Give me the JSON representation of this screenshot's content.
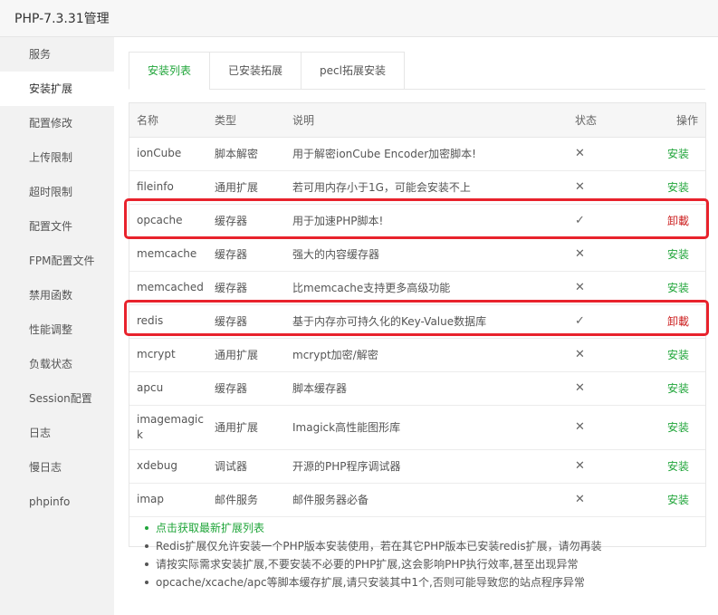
{
  "window": {
    "title": "PHP-7.3.31管理"
  },
  "sidebar": {
    "items": [
      {
        "label": "服务",
        "active": false
      },
      {
        "label": "安装扩展",
        "active": true
      },
      {
        "label": "配置修改",
        "active": false
      },
      {
        "label": "上传限制",
        "active": false
      },
      {
        "label": "超时限制",
        "active": false
      },
      {
        "label": "配置文件",
        "active": false
      },
      {
        "label": "FPM配置文件",
        "active": false
      },
      {
        "label": "禁用函数",
        "active": false
      },
      {
        "label": "性能调整",
        "active": false
      },
      {
        "label": "负载状态",
        "active": false
      },
      {
        "label": "Session配置",
        "active": false
      },
      {
        "label": "日志",
        "active": false
      },
      {
        "label": "慢日志",
        "active": false
      },
      {
        "label": "phpinfo",
        "active": false
      }
    ]
  },
  "tabs": [
    {
      "label": "安装列表",
      "active": true
    },
    {
      "label": "已安装拓展",
      "active": false
    },
    {
      "label": "pecl拓展安装",
      "active": false
    }
  ],
  "table": {
    "headers": {
      "name": "名称",
      "type": "类型",
      "desc": "说明",
      "status": "状态",
      "op": "操作"
    },
    "rows": [
      {
        "name": "ionCube",
        "type": "脚本解密",
        "desc": "用于解密ionCube Encoder加密脚本!",
        "status": "✕",
        "op": "安装",
        "installed": false
      },
      {
        "name": "fileinfo",
        "type": "通用扩展",
        "desc": "若可用内存小于1G，可能会安装不上",
        "status": "✕",
        "op": "安装",
        "installed": false
      },
      {
        "name": "opcache",
        "type": "缓存器",
        "desc": "用于加速PHP脚本!",
        "status": "✓",
        "op": "卸載",
        "installed": true
      },
      {
        "name": "memcache",
        "type": "缓存器",
        "desc": "强大的内容缓存器",
        "status": "✕",
        "op": "安装",
        "installed": false
      },
      {
        "name": "memcached",
        "type": "缓存器",
        "desc": "比memcache支持更多高级功能",
        "status": "✕",
        "op": "安装",
        "installed": false
      },
      {
        "name": "redis",
        "type": "缓存器",
        "desc": "基于内存亦可持久化的Key-Value数据库",
        "status": "✓",
        "op": "卸載",
        "installed": true
      },
      {
        "name": "mcrypt",
        "type": "通用扩展",
        "desc": "mcrypt加密/解密",
        "status": "✕",
        "op": "安装",
        "installed": false
      },
      {
        "name": "apcu",
        "type": "缓存器",
        "desc": "脚本缓存器",
        "status": "✕",
        "op": "安装",
        "installed": false
      },
      {
        "name": "imagemagick",
        "type": "通用扩展",
        "desc": "Imagick高性能图形库",
        "status": "✕",
        "op": "安装",
        "installed": false
      },
      {
        "name": "xdebug",
        "type": "调试器",
        "desc": "开源的PHP程序调试器",
        "status": "✕",
        "op": "安装",
        "installed": false
      },
      {
        "name": "imap",
        "type": "邮件服务",
        "desc": "邮件服务器必备",
        "status": "✕",
        "op": "安装",
        "installed": false
      }
    ]
  },
  "notes": {
    "fetch_link": "点击获取最新扩展列表",
    "items": [
      "Redis扩展仅允许安装一个PHP版本安装使用，若在其它PHP版本已安装redis扩展，请勿再装",
      "请按实际需求安装扩展,不要安装不必要的PHP扩展,这会影响PHP执行效率,甚至出现异常",
      "opcache/xcache/apc等脚本缓存扩展,请只安装其中1个,否则可能导致您的站点程序异常"
    ]
  },
  "colors": {
    "accent": "#20a53a",
    "danger": "#cc2020",
    "highlight": "#e8222c"
  }
}
